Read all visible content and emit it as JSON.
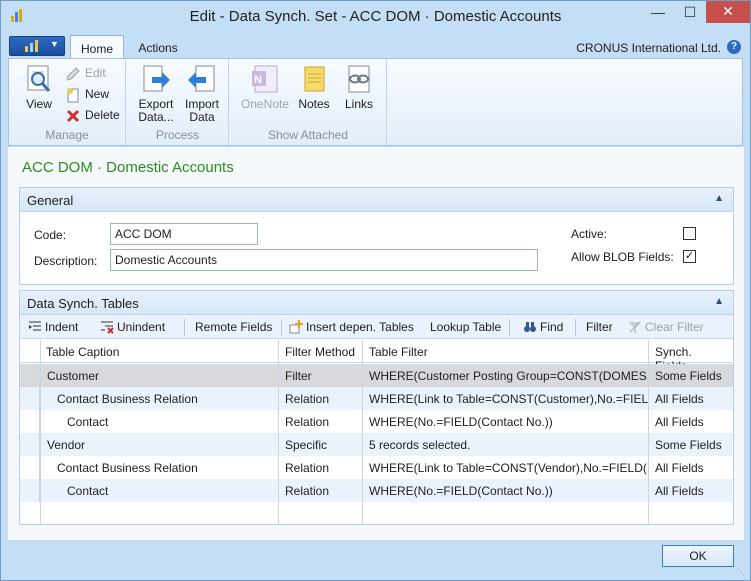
{
  "window": {
    "title": "Edit - Data Synch. Set - ACC DOM · Domestic Accounts"
  },
  "titlebar": {
    "minimize": "—",
    "maximize": "☐",
    "close": "✕"
  },
  "ribbon_tabs": {
    "home": "Home",
    "actions": "Actions",
    "company": "CRONUS International Ltd.",
    "help": "?"
  },
  "ribbon": {
    "manage": {
      "label": "Manage",
      "view": "View",
      "edit": "Edit",
      "new": "New",
      "delete": "Delete"
    },
    "process": {
      "label": "Process",
      "export": "Export Data...",
      "import": "Import Data"
    },
    "show_attached": {
      "label": "Show Attached",
      "onenote": "OneNote",
      "notes": "Notes",
      "links": "Links"
    }
  },
  "page": {
    "title": "ACC DOM · Domestic Accounts"
  },
  "general": {
    "header": "General",
    "code_label": "Code:",
    "code_value": "ACC DOM",
    "description_label": "Description:",
    "description_value": "Domestic Accounts",
    "active_label": "Active:",
    "active": false,
    "allow_blob_label": "Allow BLOB Fields:",
    "allow_blob": true
  },
  "tables": {
    "header": "Data Synch. Tables",
    "toolbar": {
      "indent": "Indent",
      "unindent": "Unindent",
      "remote_fields": "Remote Fields",
      "insert_dependent": "Insert depen. Tables",
      "lookup_table": "Lookup Table",
      "find": "Find",
      "filter": "Filter",
      "clear_filter": "Clear Filter"
    },
    "columns": [
      "Table Caption",
      "Filter Method",
      "Table Filter",
      "Synch. Fields"
    ],
    "rows": [
      {
        "caption": "Customer",
        "indent": 0,
        "method": "Filter",
        "filter": "WHERE(Customer Posting Group=CONST(DOMES...",
        "fields": "Some Fields",
        "selected": true
      },
      {
        "caption": "Contact Business Relation",
        "indent": 1,
        "method": "Relation",
        "filter": "WHERE(Link to Table=CONST(Customer),No.=FIEL...",
        "fields": "All Fields"
      },
      {
        "caption": "Contact",
        "indent": 2,
        "method": "Relation",
        "filter": "WHERE(No.=FIELD(Contact No.))",
        "fields": "All Fields"
      },
      {
        "caption": "Vendor",
        "indent": 0,
        "method": "Specific",
        "filter": "5 records selected.",
        "fields": "Some Fields"
      },
      {
        "caption": "Contact Business Relation",
        "indent": 1,
        "method": "Relation",
        "filter": "WHERE(Link to Table=CONST(Vendor),No.=FIELD(...",
        "fields": "All Fields"
      },
      {
        "caption": "Contact",
        "indent": 2,
        "method": "Relation",
        "filter": "WHERE(No.=FIELD(Contact No.))",
        "fields": "All Fields"
      }
    ]
  },
  "footer": {
    "ok": "OK"
  },
  "colors": {
    "accent_green": "#2e8b1e",
    "close_red": "#c74f4c",
    "selected_row": "#d7d9dc",
    "alt_row": "#eaf3fc"
  }
}
